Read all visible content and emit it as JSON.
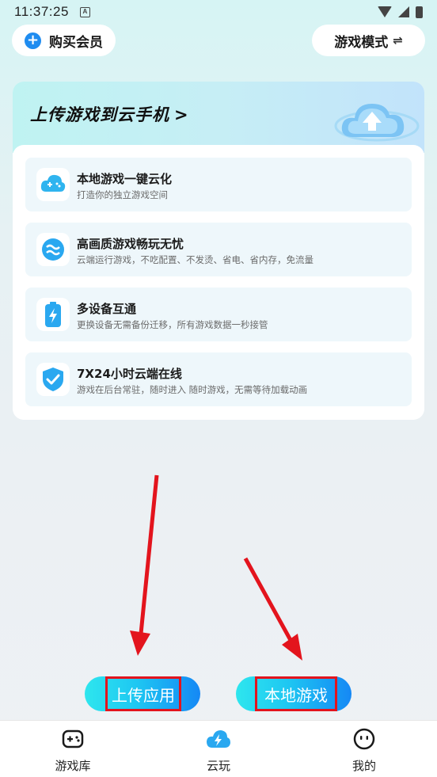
{
  "status_bar": {
    "time": "11:37:25",
    "notif_letter": "A"
  },
  "header": {
    "buy_member_label": "购买会员",
    "game_mode_label": "游戏模式",
    "game_mode_icon": "⇌"
  },
  "banner": {
    "title": "上传游戏到云手机",
    "chevron": ">"
  },
  "features": [
    {
      "title": "本地游戏一键云化",
      "desc": "打造你的独立游戏空间",
      "icon": "cloud-gamepad-icon"
    },
    {
      "title": "高画质游戏畅玩无忧",
      "desc": "云端运行游戏，不吃配置、不发烫、省电、省内存，免流量",
      "icon": "wave-icon"
    },
    {
      "title": "多设备互通",
      "desc": "更换设备无需备份迁移，所有游戏数据一秒接管",
      "icon": "battery-bolt-icon"
    },
    {
      "title": "7X24小时云端在线",
      "desc": "游戏在后台常驻，随时进入 随时游戏，无需等待加载动画",
      "icon": "shield-check-icon"
    }
  ],
  "actions": {
    "upload_label": "上传应用",
    "local_label": "本地游戏"
  },
  "bottom_nav": [
    {
      "label": "游戏库",
      "icon": "gamepad-icon"
    },
    {
      "label": "云玩",
      "icon": "cloud-bolt-icon",
      "active": true
    },
    {
      "label": "我的",
      "icon": "face-icon"
    }
  ],
  "colors": {
    "accent_blue": "#1f8cf0",
    "annotation_red": "#e3141d"
  }
}
